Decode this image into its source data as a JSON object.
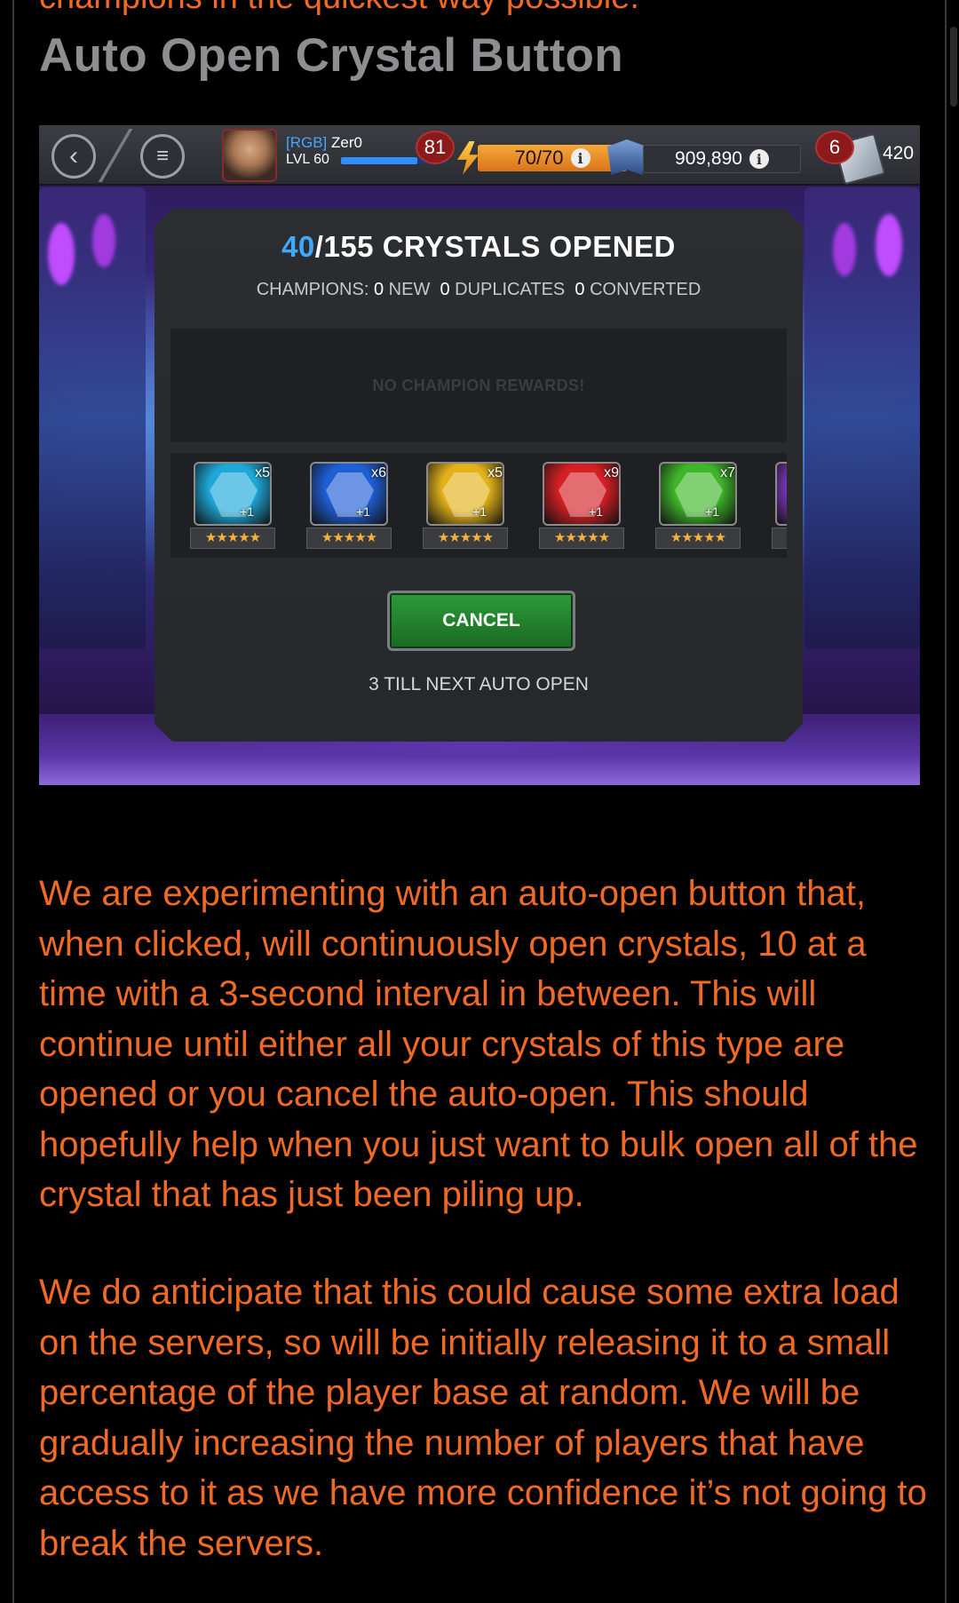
{
  "article": {
    "cut_off_line": "champions in the quickest way possible.",
    "section_title": "Auto Open Crystal Button",
    "paragraph_1": "We are experimenting with an auto-open button that, when clicked, will continuously open crystals, 10 at a time with a 3-second interval in between. This will continue until either all your crystals of this type are opened or you cancel the auto-open. This should hopefully help when you just want to bulk open all of the crystal that has just been piling up.",
    "paragraph_2": "We do anticipate that this could cause some extra load on the servers, so will be initially releasing it to a small percentage of the player base at random. We will be gradually increasing the number of players that have access to it as we have more confidence it’s not going to break the servers."
  },
  "game": {
    "topbar": {
      "back_icon": "chevron-left-icon",
      "menu_icon": "menu-icon",
      "player_tag": "[RGB]",
      "player_name": "Zer0",
      "level_label": "LVL 60",
      "xp_fraction": 0.72,
      "notification_count": "81",
      "energy": "70/70",
      "gold": "909,890",
      "units_badge": "6",
      "units": "420"
    },
    "dialog": {
      "opened": "40",
      "total_label": "/155 CRYSTALS OPENED",
      "stats_prefix": "CHAMPIONS:",
      "new_count": "0",
      "new_label": "NEW",
      "dup_count": "0",
      "dup_label": "DUPLICATES",
      "conv_count": "0",
      "conv_label": "CONVERTED",
      "no_rewards": "NO CHAMPION REWARDS!",
      "crystals": [
        {
          "count": "x5",
          "plus": "+1",
          "stars": "★★★★★",
          "color": "#1ea8d8"
        },
        {
          "count": "x6",
          "plus": "+1",
          "stars": "★★★★★",
          "color": "#1f5fd6"
        },
        {
          "count": "x5",
          "plus": "+1",
          "stars": "★★★★★",
          "color": "#e3b21a"
        },
        {
          "count": "x9",
          "plus": "+1",
          "stars": "★★★★★",
          "color": "#d41f24"
        },
        {
          "count": "x7",
          "plus": "+1",
          "stars": "★★★★★",
          "color": "#3fb52a"
        },
        {
          "count": "",
          "plus": "",
          "stars": "★",
          "color": "#8a3ad0"
        }
      ],
      "cancel_label": "CANCEL",
      "next_open_note": "3 TILL NEXT AUTO OPEN"
    }
  }
}
